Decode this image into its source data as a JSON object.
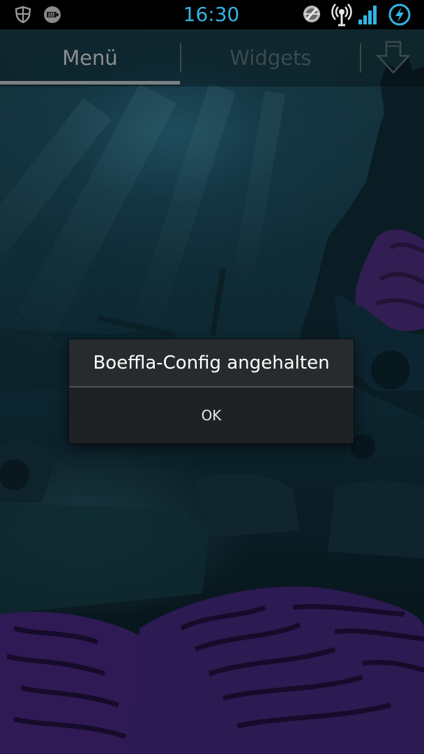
{
  "status_bar": {
    "time": "16:30",
    "icons": [
      "shield-icon",
      "battery-tool-icon",
      "gear-tool-icon",
      "wifi-hotspot-icon",
      "signal-icon",
      "charging-icon"
    ],
    "clock_color": "#33b5e5"
  },
  "tabs": [
    {
      "label": "Menü",
      "selected": true
    },
    {
      "label": "Widgets",
      "selected": false
    }
  ],
  "tab_bar": {
    "store_icon": "download-arrow-icon"
  },
  "dialog": {
    "title": "Boeffla-Config angehalten",
    "ok_label": "OK"
  },
  "colors": {
    "accent": "#33b5e5",
    "dialog_bg": "#282b2d",
    "status_bar_bg": "#000000"
  }
}
